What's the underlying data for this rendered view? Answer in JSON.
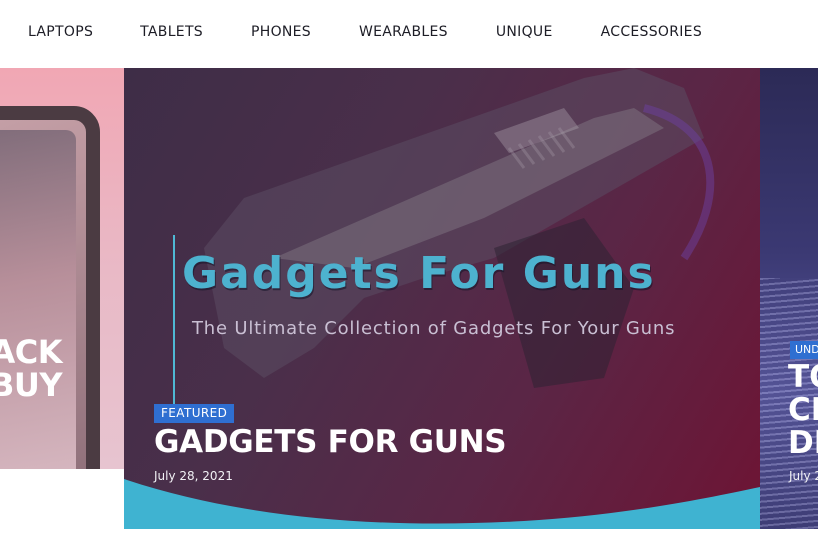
{
  "nav": {
    "items": [
      "LAPTOPS",
      "TABLETS",
      "PHONES",
      "WEARABLES",
      "UNIQUE",
      "ACCESSORIES"
    ]
  },
  "slider": {
    "left": {
      "title_lines": [
        "ACK",
        "BUY"
      ]
    },
    "main": {
      "promo_title": "Gadgets For Guns",
      "promo_subtitle": "The Ultimate Collection of Gadgets For Your Guns",
      "badge": "FEATURED",
      "post_title": "GADGETS FOR GUNS",
      "date": "July 28, 2021"
    },
    "right": {
      "badge": "UND",
      "title_lines": [
        "TO",
        "CE",
        "DE"
      ],
      "date": "July 2"
    }
  },
  "colors": {
    "badge": "#2f6fd1",
    "promo_title": "#4db2cf",
    "wave": "#3fb3d1"
  }
}
